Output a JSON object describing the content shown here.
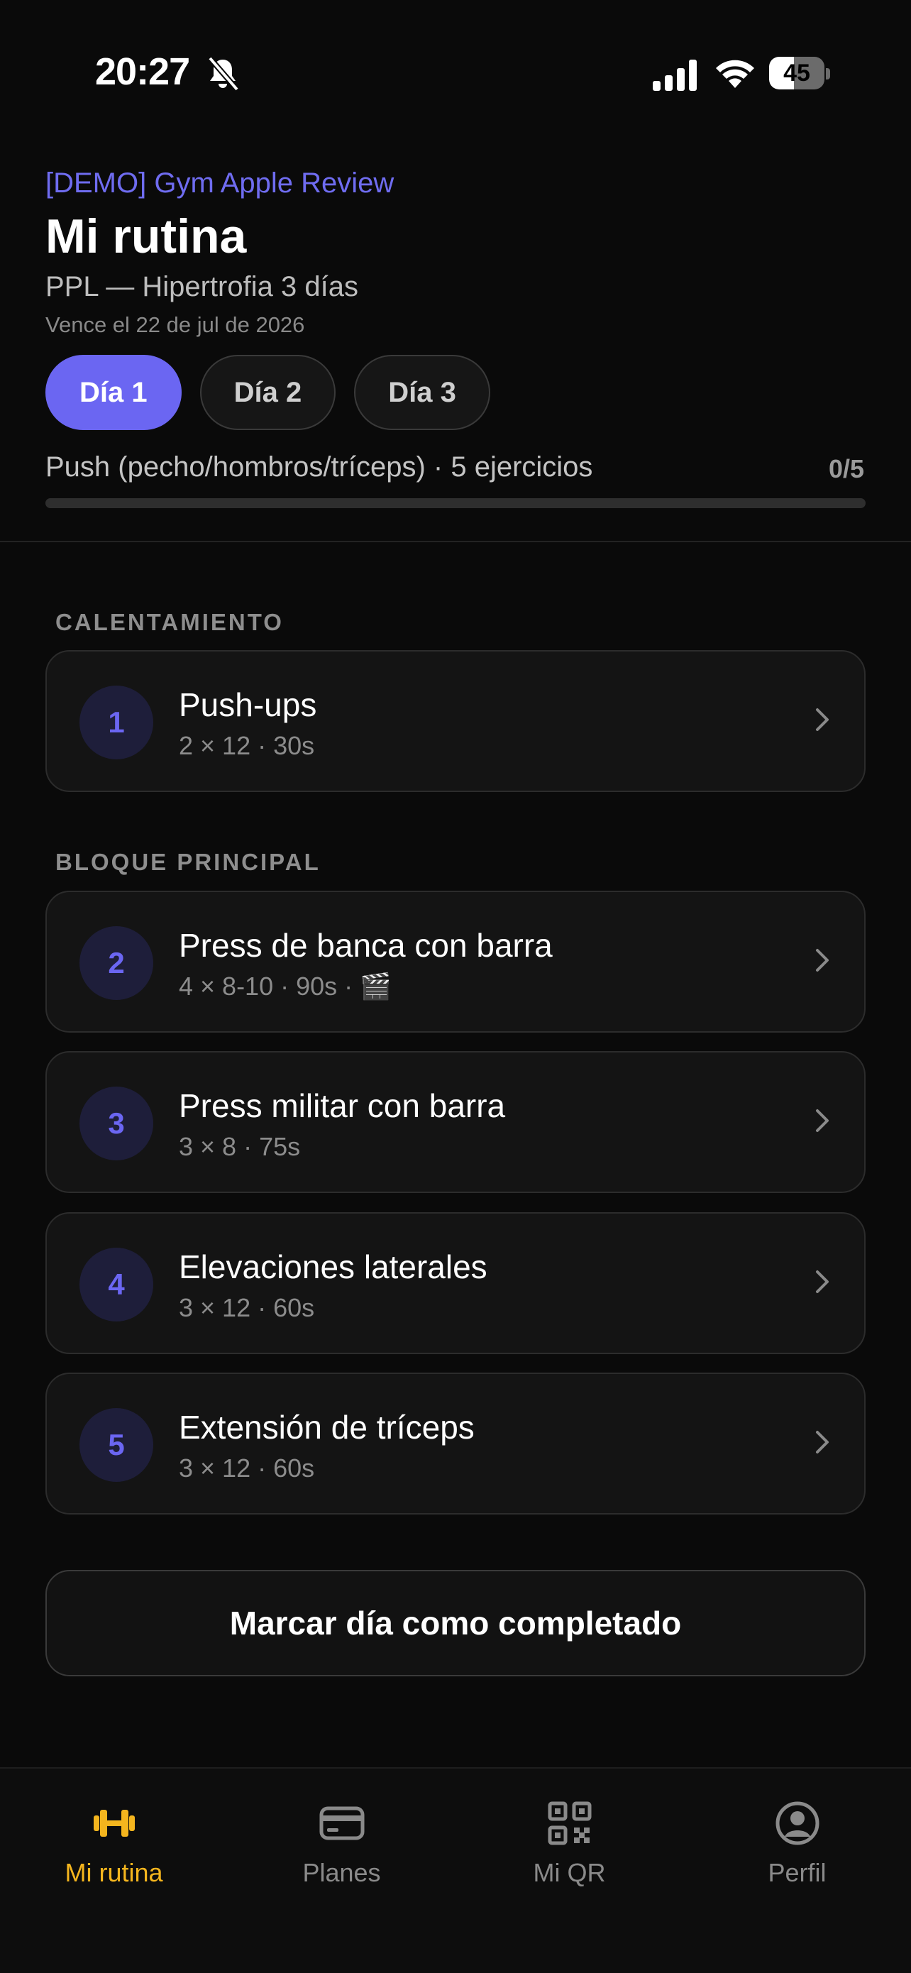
{
  "status_bar": {
    "time": "20:27",
    "battery": "45",
    "battery_level": 0.45
  },
  "header": {
    "gym_name": "[DEMO] Gym Apple Review",
    "title": "Mi rutina",
    "plan": "PPL — Hipertrofia 3 días",
    "expires": "Vence el 22 de jul de 2026"
  },
  "tabs": [
    {
      "label": "Día 1",
      "active": true
    },
    {
      "label": "Día 2",
      "active": false
    },
    {
      "label": "Día 3",
      "active": false
    }
  ],
  "day": {
    "info": "Push (pecho/hombros/tríceps) · 5 ejercicios",
    "count": "0/5",
    "progress": 0
  },
  "sections": [
    {
      "title": "CALENTAMIENTO"
    },
    {
      "title": "BLOQUE PRINCIPAL"
    }
  ],
  "exercises": [
    {
      "number": "1",
      "name": "Push-ups",
      "meta": "2 × 12 · 30s"
    },
    {
      "number": "2",
      "name": "Press de banca con barra",
      "meta": "4 × 8-10 · 90s · 🎬"
    },
    {
      "number": "3",
      "name": "Press militar con barra",
      "meta": "3 × 8 · 75s"
    },
    {
      "number": "4",
      "name": "Elevaciones laterales",
      "meta": "3 × 12 · 60s"
    },
    {
      "number": "5",
      "name": "Extensión de tríceps",
      "meta": "3 × 12 · 60s"
    }
  ],
  "actions": {
    "complete_label": "Marcar día como completado"
  },
  "nav": [
    {
      "label": "Mi rutina",
      "icon": "dumbbell-icon",
      "active": true
    },
    {
      "label": "Planes",
      "icon": "card-icon",
      "active": false
    },
    {
      "label": "Mi QR",
      "icon": "qr-code-icon",
      "active": false
    },
    {
      "label": "Perfil",
      "icon": "profile-icon",
      "active": false
    }
  ],
  "colors": {
    "accent": "#6b66f2",
    "nav_active": "#f4b51e",
    "background": "#0a0a0a"
  }
}
